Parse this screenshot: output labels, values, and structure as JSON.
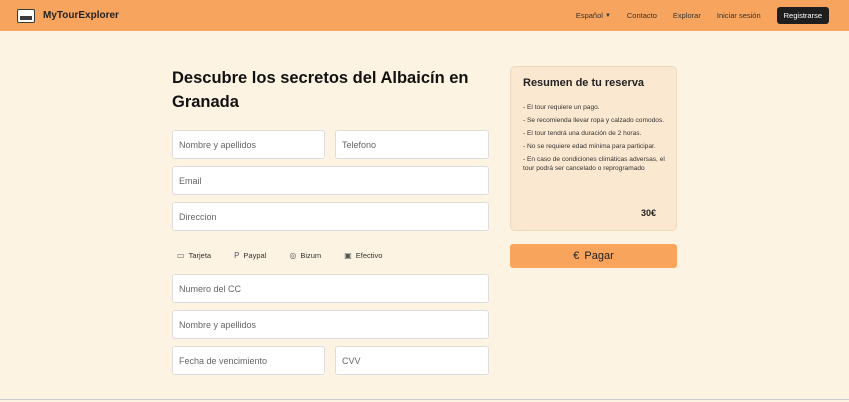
{
  "header": {
    "brand": "MyTourExplorer",
    "language": "Español",
    "links": [
      "Contacto",
      "Explorar",
      "Iniciar sesión"
    ],
    "register": "Registrarse"
  },
  "form": {
    "title": "Descubre los secretos del Albaicín en Granada",
    "name_placeholder": "Nombre y apellidos",
    "phone_placeholder": "Telefono",
    "email_placeholder": "Email",
    "address_placeholder": "Direccion",
    "payment_methods": [
      "Tarjeta",
      "Paypal",
      "Bizum",
      "Efectivo"
    ],
    "card_number_placeholder": "Numero del CC",
    "card_name_placeholder": "Nombre y apellidos",
    "expiry_placeholder": "Fecha de vencimiento",
    "cvv_placeholder": "CVV"
  },
  "summary": {
    "title": "Resumen de tu reserva",
    "items": [
      "- El tour requiere un pago.",
      "- Se recomienda llevar ropa y calzado comodos.",
      "- El tour tendrá una duración de 2 horas.",
      "- No se requiere edad mínima para participar.",
      "- En caso de condiciones climáticas adversas, el tour podrá ser cancelado o reprogramado"
    ],
    "price": "30€",
    "pay_button": "Pagar",
    "pay_symbol": "€"
  },
  "icons": {
    "card": "card-icon",
    "paypal": "paypal-icon",
    "bizum": "bizum-icon",
    "cash": "cash-icon"
  }
}
